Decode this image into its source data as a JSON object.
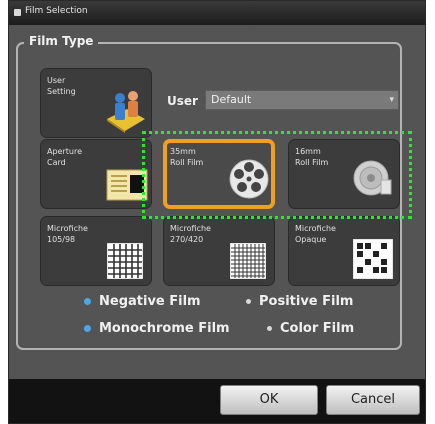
{
  "window": {
    "title": "Film Selection"
  },
  "film_type": {
    "label": "Film Type",
    "tiles": [
      {
        "line1": "User",
        "line2": "Setting"
      },
      {
        "line1": "Aperture",
        "line2": "Card"
      },
      {
        "line1": "35mm",
        "line2": "Roll Film"
      },
      {
        "line1": "16mm",
        "line2": "Roll Film"
      },
      {
        "line1": "Microfiche",
        "line2": "105/98"
      },
      {
        "line1": "Microfiche",
        "line2": "270/420"
      },
      {
        "line1": "Microfiche",
        "line2": "Opaque"
      }
    ],
    "selected_tile": "35mm Roll Film"
  },
  "user": {
    "label": "User",
    "value": "Default"
  },
  "options": {
    "negative": "Negative Film",
    "positive": "Positive Film",
    "monochrome": "Monochrome Film",
    "color": "Color Film"
  },
  "buttons": {
    "ok": "OK",
    "cancel": "Cancel"
  },
  "colors": {
    "selected_border": "#f0a020",
    "highlight_dots": "#22ee22",
    "radio_selected": "#4aa8e8"
  }
}
